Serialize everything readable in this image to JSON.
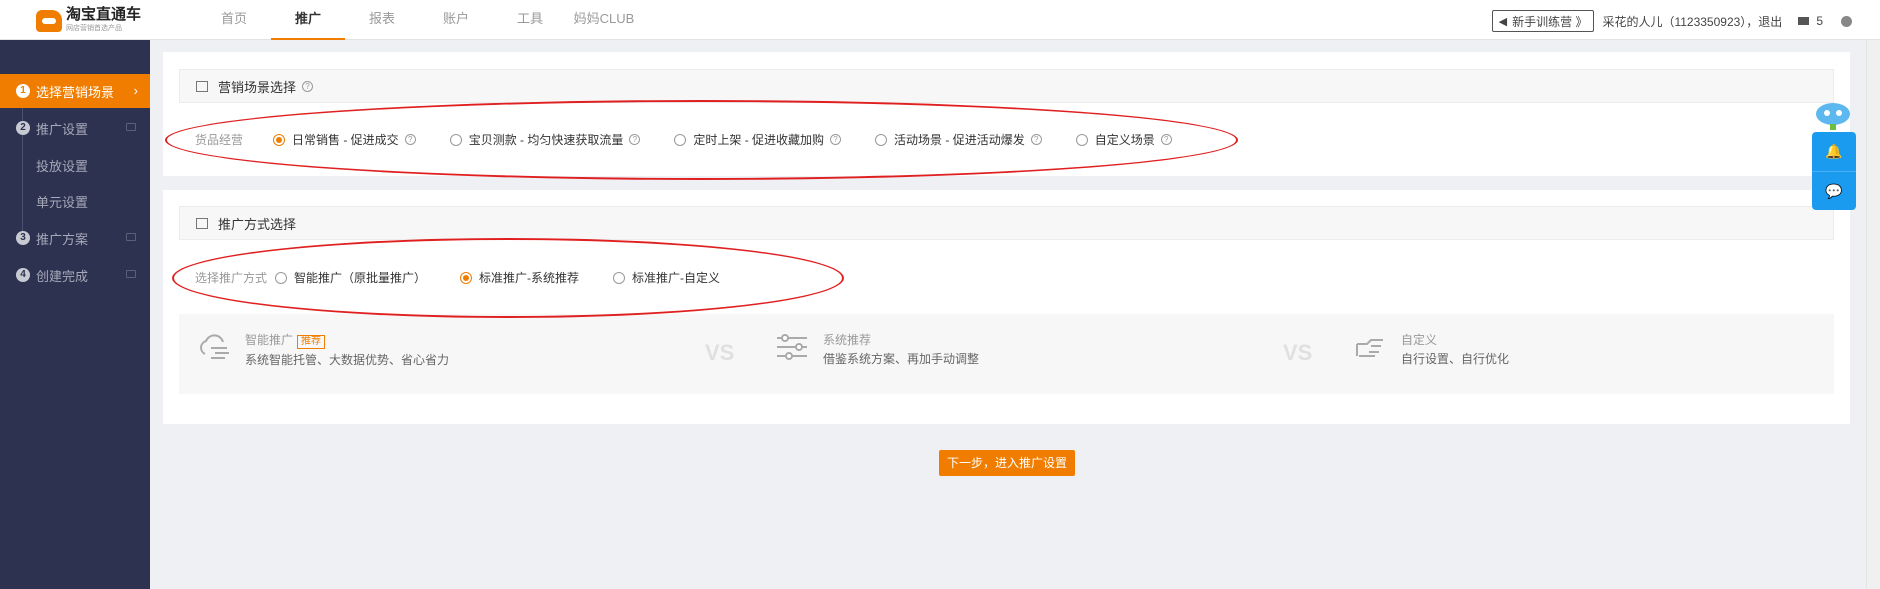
{
  "app": {
    "logo_title": "淘宝直通车",
    "logo_sub": "网店营销首选产品"
  },
  "nav": {
    "items": [
      "首页",
      "推广",
      "报表",
      "账户",
      "工具",
      "妈妈CLUB"
    ],
    "active": "推广"
  },
  "topbar": {
    "train_label": "新手训练营 》",
    "user": "采花的人儿（1123350923），退出",
    "mail_count": "5"
  },
  "sidebar": {
    "items": [
      {
        "num": "1",
        "label": "选择营销场景"
      },
      {
        "num": "2",
        "label": "推广设置"
      },
      {
        "num": "",
        "label": "投放设置"
      },
      {
        "num": "",
        "label": "单元设置"
      },
      {
        "num": "3",
        "label": "推广方案"
      },
      {
        "num": "4",
        "label": "创建完成"
      }
    ]
  },
  "scene_section": {
    "title": "营销场景选择",
    "row_label": "货品经营",
    "options": [
      "日常销售 - 促进成交",
      "宝贝测款 - 均匀快速获取流量",
      "定时上架 - 促进收藏加购",
      "活动场景 - 促进活动爆发",
      "自定义场景"
    ],
    "selected_index": 0
  },
  "method_section": {
    "title": "推广方式选择",
    "row_label": "选择推广方式",
    "options": [
      "智能推广（原批量推广）",
      "标准推广-系统推荐",
      "标准推广-自定义"
    ],
    "selected_index": 1
  },
  "compare": {
    "items": [
      {
        "icon": "cloud-flow-icon",
        "title": "智能推广",
        "tag": "推荐",
        "desc": "系统智能托管、大数据优势、省心省力"
      },
      {
        "icon": "sliders-icon",
        "title": "系统推荐",
        "tag": "",
        "desc": "借鉴系统方案、再加手动调整"
      },
      {
        "icon": "hand-point-icon",
        "title": "自定义",
        "tag": "",
        "desc": "自行设置、自行优化"
      }
    ],
    "vs_label": "VS"
  },
  "next_button": "下一步，进入推广设置",
  "colors": {
    "accent": "#f07d00",
    "sidebar_bg": "#2d3250",
    "float_blue": "#1a9bf0",
    "annotation_red": "#e02020"
  }
}
